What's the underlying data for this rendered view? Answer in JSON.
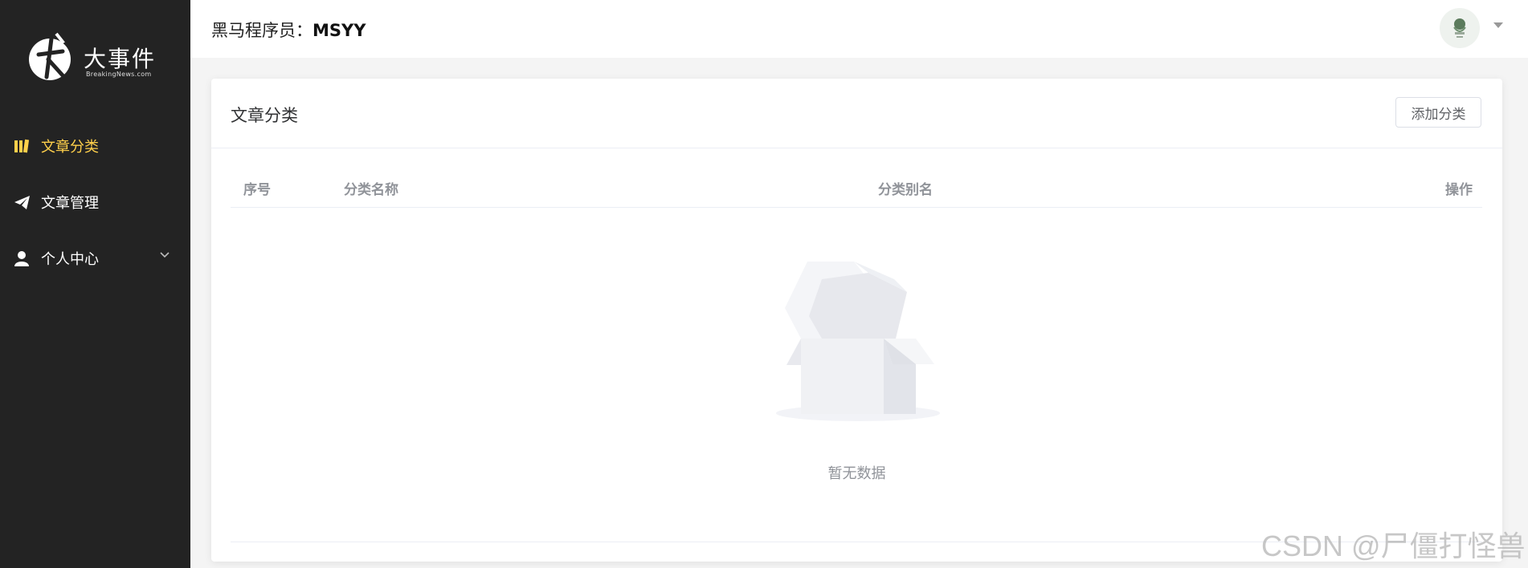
{
  "sidebar": {
    "logo": {
      "title": "大事件",
      "subtitle": "BreakingNews.com"
    },
    "items": [
      {
        "label": "文章分类",
        "icon": "book-icon",
        "active": true
      },
      {
        "label": "文章管理",
        "icon": "paper-plane-icon",
        "active": false
      },
      {
        "label": "个人中心",
        "icon": "user-icon",
        "active": false
      }
    ]
  },
  "header": {
    "welcome_prefix": "黑马程序员：",
    "username": "MSYY"
  },
  "card": {
    "title": "文章分类",
    "add_button": "添加分类",
    "columns": [
      "序号",
      "分类名称",
      "分类别名",
      "操作"
    ],
    "empty_text": "暂无数据"
  },
  "watermark": "CSDN @尸僵打怪兽",
  "colors": {
    "sidebar_bg": "#232323",
    "active": "#ffd04b"
  }
}
